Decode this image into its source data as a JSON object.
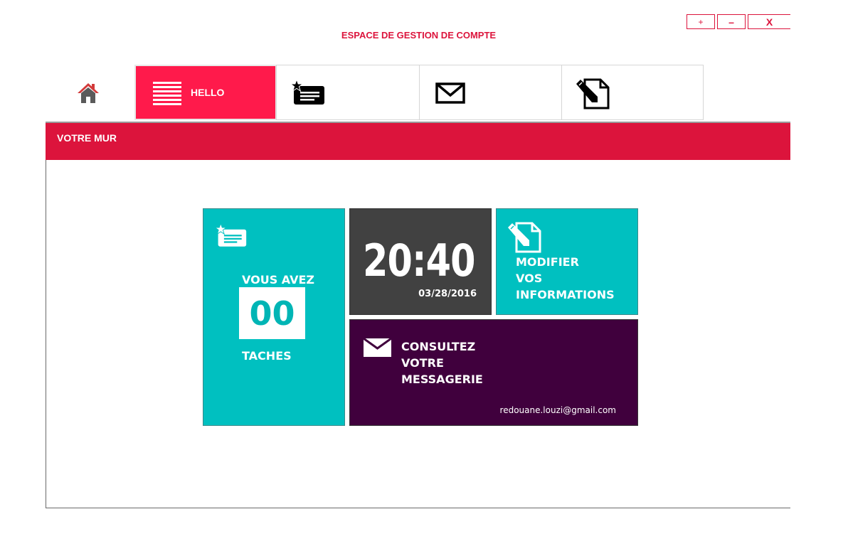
{
  "window": {
    "title": "ESPACE DE GESTION DE COMPTE",
    "maximize_label": "+",
    "minimize_label": "–",
    "close_label": "X"
  },
  "nav": {
    "home_icon": "home-icon",
    "tabs": [
      {
        "label": "HELLO",
        "icon": "list-icon",
        "active": true
      },
      {
        "label": "",
        "icon": "tasks-star-icon",
        "active": false
      },
      {
        "label": "",
        "icon": "mail-icon",
        "active": false
      },
      {
        "label": "",
        "icon": "edit-document-icon",
        "active": false
      }
    ]
  },
  "wall": {
    "header": "VOTRE MUR"
  },
  "tiles": {
    "tasks": {
      "lead": "VOUS AVEZ",
      "count": "00",
      "tail": "TACHES",
      "icon": "tasks-star-icon"
    },
    "clock": {
      "time": "20:40",
      "date": "03/28/2016"
    },
    "modify": {
      "line1": "MODIFIER",
      "line2": "VOS",
      "line3": "INFORMATIONS",
      "icon": "edit-document-icon"
    },
    "messages": {
      "line1": "CONSULTEZ",
      "line2": "VOTRE",
      "line3": "MESSAGERIE",
      "email": "redouane.louzi@gmail.com",
      "icon": "mail-icon"
    }
  },
  "colors": {
    "accent": "#dc143c",
    "active_tab": "#ff1a4b",
    "teal": "#00c0c0",
    "dark_gray": "#414141",
    "purple": "#40003d"
  }
}
